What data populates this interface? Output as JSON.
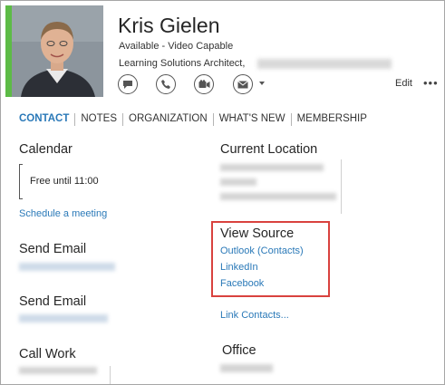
{
  "contact": {
    "name": "Kris Gielen",
    "status": "Available - Video Capable",
    "job_title": "Learning Solutions Architect,",
    "presence_color": "#5dbb46"
  },
  "actions": {
    "icons": [
      "chat-bubble-icon",
      "phone-icon",
      "video-camera-icon",
      "mail-icon",
      "chevron-down-icon"
    ],
    "edit_label": "Edit",
    "more_label": "•••"
  },
  "tabs": [
    {
      "label": "CONTACT",
      "active": true
    },
    {
      "label": "NOTES",
      "active": false
    },
    {
      "label": "ORGANIZATION",
      "active": false
    },
    {
      "label": "WHAT'S NEW",
      "active": false
    },
    {
      "label": "MEMBERSHIP",
      "active": false
    }
  ],
  "left": {
    "calendar_title": "Calendar",
    "free_text": "Free until 11:00",
    "schedule_link": "Schedule a meeting",
    "email1_title": "Send Email",
    "email2_title": "Send Email",
    "callwork_title": "Call Work"
  },
  "right": {
    "location_title": "Current Location",
    "view_source_title": "View Source",
    "sources": [
      "Outlook (Contacts)",
      "LinkedIn",
      "Facebook"
    ],
    "link_contacts": "Link Contacts...",
    "office_title": "Office"
  },
  "colors": {
    "accent": "#2a79b8",
    "highlight_border": "#d9423e"
  }
}
